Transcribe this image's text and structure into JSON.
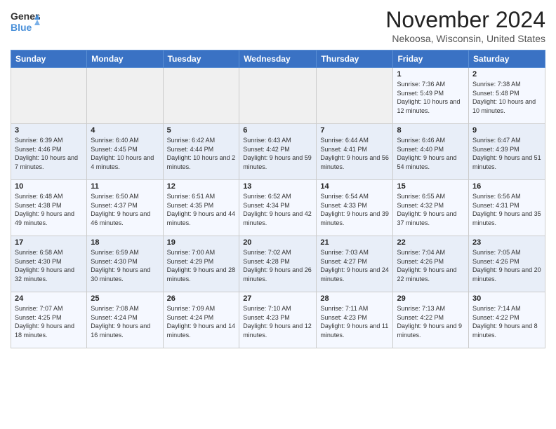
{
  "header": {
    "logo_line1": "General",
    "logo_line2": "Blue",
    "month_title": "November 2024",
    "location": "Nekoosa, Wisconsin, United States"
  },
  "days_of_week": [
    "Sunday",
    "Monday",
    "Tuesday",
    "Wednesday",
    "Thursday",
    "Friday",
    "Saturday"
  ],
  "weeks": [
    [
      {
        "day": "",
        "info": ""
      },
      {
        "day": "",
        "info": ""
      },
      {
        "day": "",
        "info": ""
      },
      {
        "day": "",
        "info": ""
      },
      {
        "day": "",
        "info": ""
      },
      {
        "day": "1",
        "info": "Sunrise: 7:36 AM\nSunset: 5:49 PM\nDaylight: 10 hours and 12 minutes."
      },
      {
        "day": "2",
        "info": "Sunrise: 7:38 AM\nSunset: 5:48 PM\nDaylight: 10 hours and 10 minutes."
      }
    ],
    [
      {
        "day": "3",
        "info": "Sunrise: 6:39 AM\nSunset: 4:46 PM\nDaylight: 10 hours and 7 minutes."
      },
      {
        "day": "4",
        "info": "Sunrise: 6:40 AM\nSunset: 4:45 PM\nDaylight: 10 hours and 4 minutes."
      },
      {
        "day": "5",
        "info": "Sunrise: 6:42 AM\nSunset: 4:44 PM\nDaylight: 10 hours and 2 minutes."
      },
      {
        "day": "6",
        "info": "Sunrise: 6:43 AM\nSunset: 4:42 PM\nDaylight: 9 hours and 59 minutes."
      },
      {
        "day": "7",
        "info": "Sunrise: 6:44 AM\nSunset: 4:41 PM\nDaylight: 9 hours and 56 minutes."
      },
      {
        "day": "8",
        "info": "Sunrise: 6:46 AM\nSunset: 4:40 PM\nDaylight: 9 hours and 54 minutes."
      },
      {
        "day": "9",
        "info": "Sunrise: 6:47 AM\nSunset: 4:39 PM\nDaylight: 9 hours and 51 minutes."
      }
    ],
    [
      {
        "day": "10",
        "info": "Sunrise: 6:48 AM\nSunset: 4:38 PM\nDaylight: 9 hours and 49 minutes."
      },
      {
        "day": "11",
        "info": "Sunrise: 6:50 AM\nSunset: 4:37 PM\nDaylight: 9 hours and 46 minutes."
      },
      {
        "day": "12",
        "info": "Sunrise: 6:51 AM\nSunset: 4:35 PM\nDaylight: 9 hours and 44 minutes."
      },
      {
        "day": "13",
        "info": "Sunrise: 6:52 AM\nSunset: 4:34 PM\nDaylight: 9 hours and 42 minutes."
      },
      {
        "day": "14",
        "info": "Sunrise: 6:54 AM\nSunset: 4:33 PM\nDaylight: 9 hours and 39 minutes."
      },
      {
        "day": "15",
        "info": "Sunrise: 6:55 AM\nSunset: 4:32 PM\nDaylight: 9 hours and 37 minutes."
      },
      {
        "day": "16",
        "info": "Sunrise: 6:56 AM\nSunset: 4:31 PM\nDaylight: 9 hours and 35 minutes."
      }
    ],
    [
      {
        "day": "17",
        "info": "Sunrise: 6:58 AM\nSunset: 4:30 PM\nDaylight: 9 hours and 32 minutes."
      },
      {
        "day": "18",
        "info": "Sunrise: 6:59 AM\nSunset: 4:30 PM\nDaylight: 9 hours and 30 minutes."
      },
      {
        "day": "19",
        "info": "Sunrise: 7:00 AM\nSunset: 4:29 PM\nDaylight: 9 hours and 28 minutes."
      },
      {
        "day": "20",
        "info": "Sunrise: 7:02 AM\nSunset: 4:28 PM\nDaylight: 9 hours and 26 minutes."
      },
      {
        "day": "21",
        "info": "Sunrise: 7:03 AM\nSunset: 4:27 PM\nDaylight: 9 hours and 24 minutes."
      },
      {
        "day": "22",
        "info": "Sunrise: 7:04 AM\nSunset: 4:26 PM\nDaylight: 9 hours and 22 minutes."
      },
      {
        "day": "23",
        "info": "Sunrise: 7:05 AM\nSunset: 4:26 PM\nDaylight: 9 hours and 20 minutes."
      }
    ],
    [
      {
        "day": "24",
        "info": "Sunrise: 7:07 AM\nSunset: 4:25 PM\nDaylight: 9 hours and 18 minutes."
      },
      {
        "day": "25",
        "info": "Sunrise: 7:08 AM\nSunset: 4:24 PM\nDaylight: 9 hours and 16 minutes."
      },
      {
        "day": "26",
        "info": "Sunrise: 7:09 AM\nSunset: 4:24 PM\nDaylight: 9 hours and 14 minutes."
      },
      {
        "day": "27",
        "info": "Sunrise: 7:10 AM\nSunset: 4:23 PM\nDaylight: 9 hours and 12 minutes."
      },
      {
        "day": "28",
        "info": "Sunrise: 7:11 AM\nSunset: 4:23 PM\nDaylight: 9 hours and 11 minutes."
      },
      {
        "day": "29",
        "info": "Sunrise: 7:13 AM\nSunset: 4:22 PM\nDaylight: 9 hours and 9 minutes."
      },
      {
        "day": "30",
        "info": "Sunrise: 7:14 AM\nSunset: 4:22 PM\nDaylight: 9 hours and 8 minutes."
      }
    ]
  ]
}
